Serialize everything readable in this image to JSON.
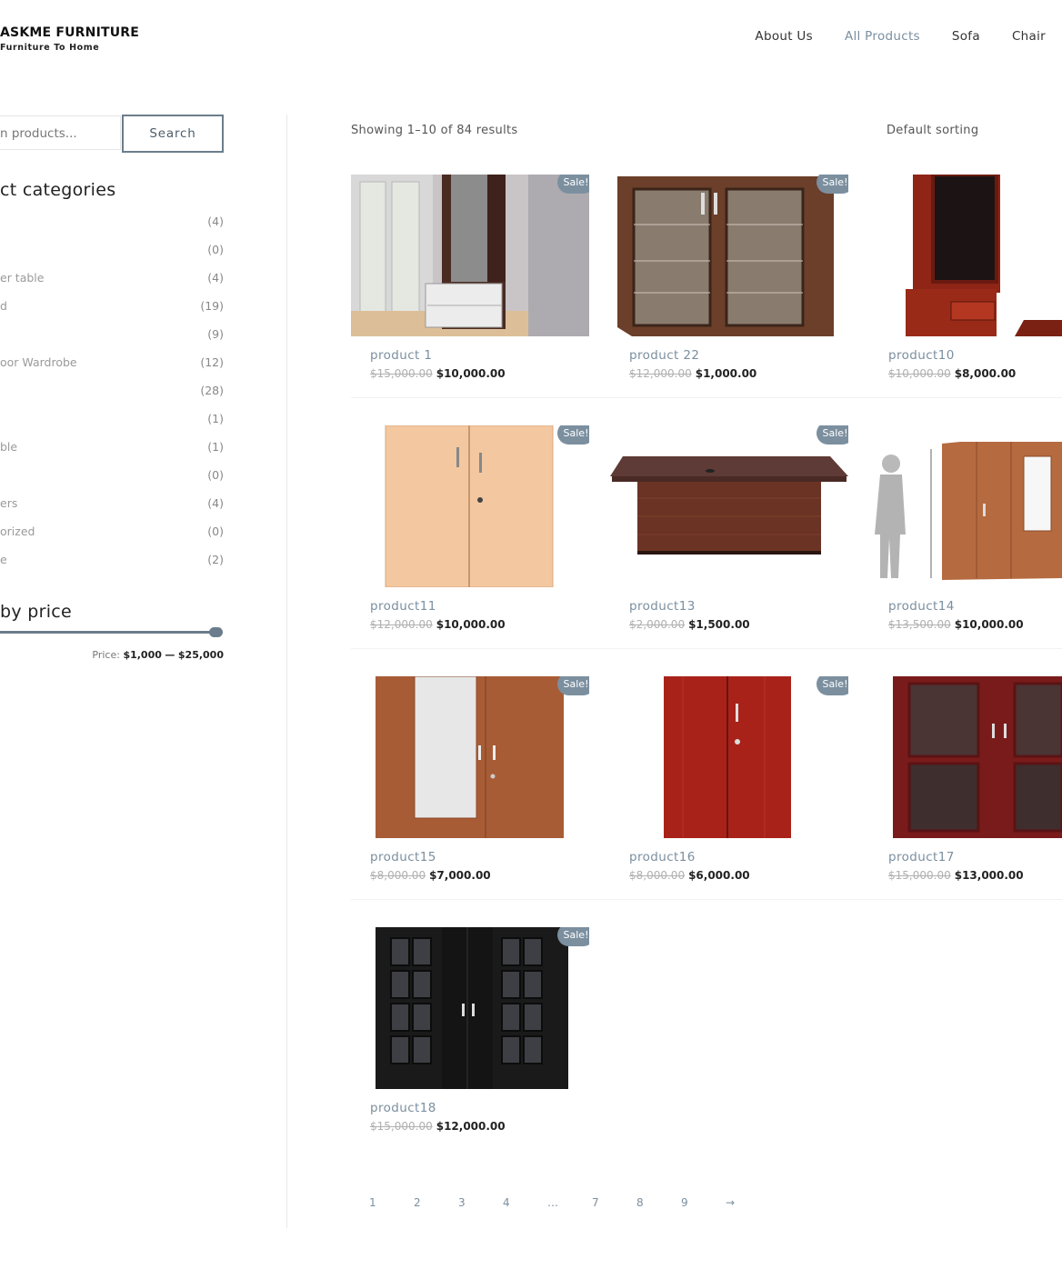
{
  "brand": {
    "name": "ASKME FURNITURE",
    "tagline": "Furniture To Home"
  },
  "nav": {
    "items": [
      "About Us",
      "All Products",
      "Sofa",
      "Chair"
    ],
    "active_index": 1
  },
  "search": {
    "placeholder": "n products...",
    "button": "Search"
  },
  "categories": {
    "title": "ct categories",
    "items": [
      {
        "name": "",
        "count": "(4)"
      },
      {
        "name": "",
        "count": "(0)"
      },
      {
        "name": "er table",
        "count": "(4)"
      },
      {
        "name": "d",
        "count": "(19)"
      },
      {
        "name": "",
        "count": "(9)"
      },
      {
        "name": "oor Wardrobe",
        "count": "(12)"
      },
      {
        "name": "",
        "count": "(28)"
      },
      {
        "name": "",
        "count": "(1)"
      },
      {
        "name": "ble",
        "count": "(1)"
      },
      {
        "name": "",
        "count": "(0)"
      },
      {
        "name": "ers",
        "count": "(4)"
      },
      {
        "name": "orized",
        "count": "(0)"
      },
      {
        "name": "e",
        "count": "(2)"
      }
    ]
  },
  "price_filter": {
    "title": "by price",
    "label": "Price:",
    "min": "$1,000",
    "max": "$25,000",
    "sep": "—",
    "slider_fraction": 1.0
  },
  "results": {
    "count_text": "Showing 1–10 of 84 results",
    "sorting": "Default sorting"
  },
  "sale_label": "Sale!",
  "products": [
    {
      "name": "product 1",
      "old_price": "$15,000.00",
      "price": "$10,000.00",
      "sale": true
    },
    {
      "name": "product 22",
      "old_price": "$12,000.00",
      "price": "$1,000.00",
      "sale": true
    },
    {
      "name": "product10",
      "old_price": "$10,000.00",
      "price": "$8,000.00",
      "sale": false
    },
    {
      "name": "product11",
      "old_price": "$12,000.00",
      "price": "$10,000.00",
      "sale": true
    },
    {
      "name": "product13",
      "old_price": "$2,000.00",
      "price": "$1,500.00",
      "sale": true
    },
    {
      "name": "product14",
      "old_price": "$13,500.00",
      "price": "$10,000.00",
      "sale": false
    },
    {
      "name": "product15",
      "old_price": "$8,000.00",
      "price": "$7,000.00",
      "sale": true
    },
    {
      "name": "product16",
      "old_price": "$8,000.00",
      "price": "$6,000.00",
      "sale": true
    },
    {
      "name": "product17",
      "old_price": "$15,000.00",
      "price": "$13,000.00",
      "sale": false
    },
    {
      "name": "product18",
      "old_price": "$15,000.00",
      "price": "$12,000.00",
      "sale": true
    }
  ],
  "pagination": [
    "1",
    "2",
    "3",
    "4",
    "…",
    "7",
    "8",
    "9",
    "→"
  ]
}
